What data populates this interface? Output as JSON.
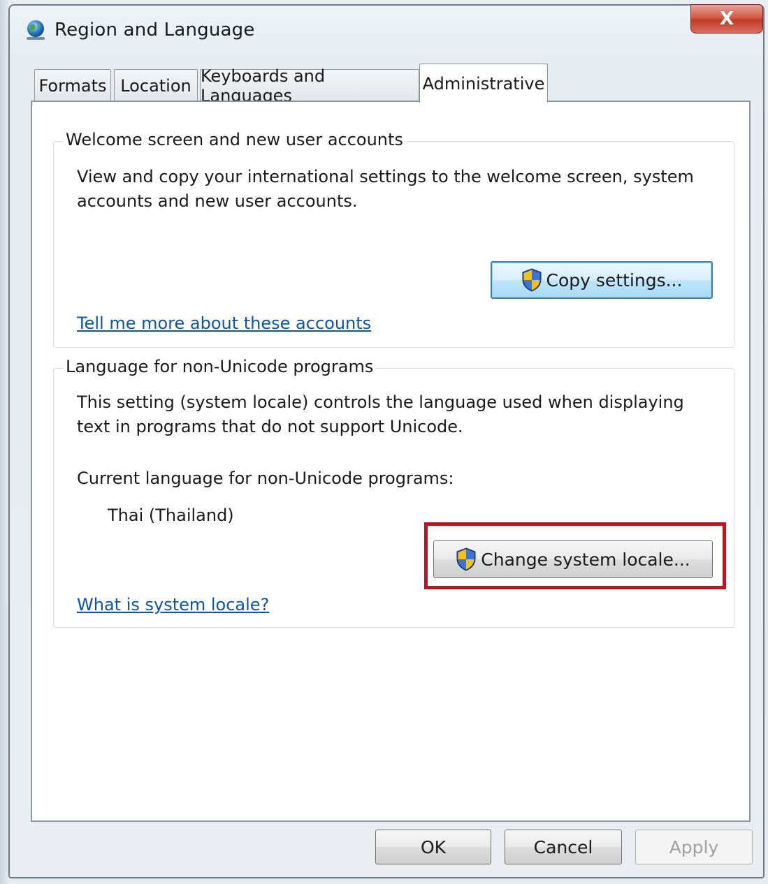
{
  "window": {
    "title": "Region and Language",
    "close_label": "X"
  },
  "tabs": [
    {
      "label": "Formats",
      "active": false
    },
    {
      "label": "Location",
      "active": false
    },
    {
      "label": "Keyboards and Languages",
      "active": false
    },
    {
      "label": "Administrative",
      "active": true
    }
  ],
  "welcome_group": {
    "title": "Welcome screen and new user accounts",
    "description_line1": "View and copy your international settings to the welcome screen, system",
    "description_line2": "accounts and new user accounts.",
    "button_label": "Copy settings...",
    "link": "Tell me more about these accounts"
  },
  "unicode_group": {
    "title": "Language for non-Unicode programs",
    "description_line1": "This setting (system locale) controls the language used when displaying",
    "description_line2": "text in programs that do not support Unicode.",
    "current_label": "Current language for non-Unicode programs:",
    "current_value": "Thai (Thailand)",
    "button_label": "Change system locale...",
    "link": "What is system locale?"
  },
  "footer": {
    "ok_label": "OK",
    "cancel_label": "Cancel",
    "apply_label": "Apply"
  },
  "colors": {
    "highlight": "#c1121f",
    "link": "#0b55a8",
    "close_button": "#c13a28"
  },
  "icons": {
    "app": "globe-icon",
    "uac": "uac-shield-icon"
  }
}
